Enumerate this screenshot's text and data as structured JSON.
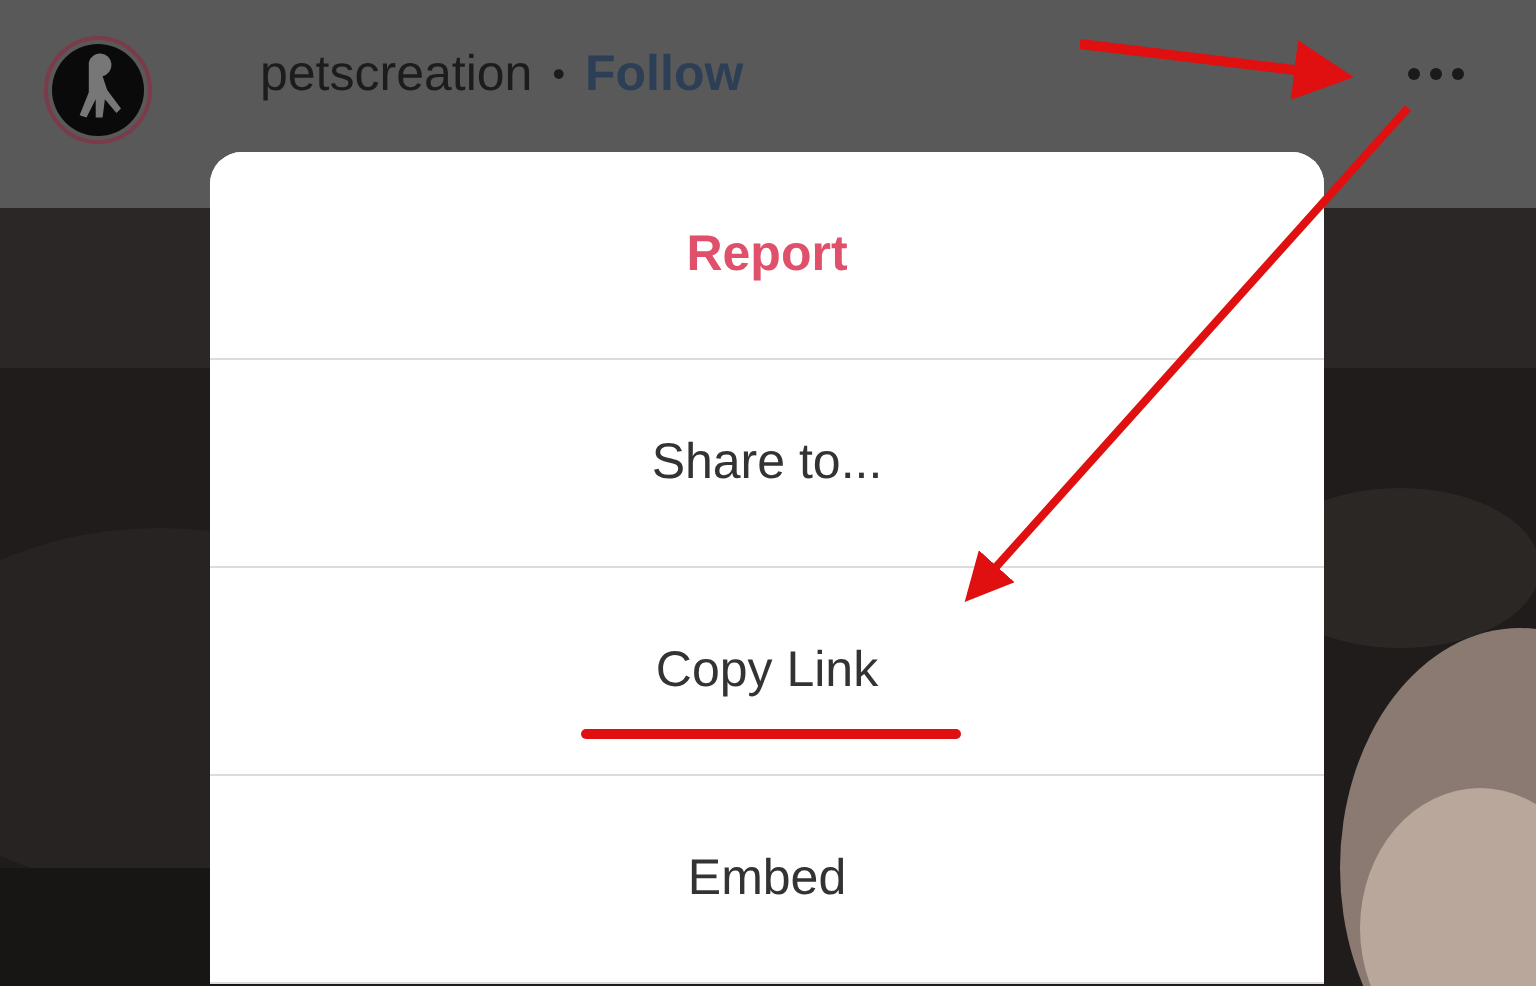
{
  "post_header": {
    "username": "petscreation",
    "separator": "•",
    "follow": "Follow"
  },
  "menu": {
    "items": [
      {
        "label": "Report",
        "kind": "danger"
      },
      {
        "label": "Share to...",
        "kind": "normal"
      },
      {
        "label": "Copy Link",
        "kind": "normal"
      },
      {
        "label": "Embed",
        "kind": "normal"
      }
    ]
  }
}
